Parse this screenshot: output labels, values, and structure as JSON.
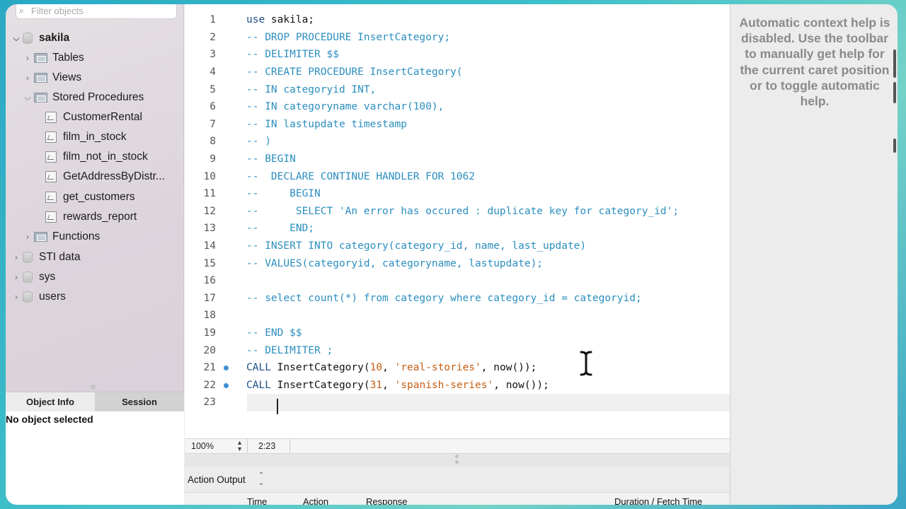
{
  "sidebar": {
    "filter_placeholder": "Filter objects",
    "tree": {
      "schema": "sakila",
      "tables": "Tables",
      "views": "Views",
      "stored_procedures": "Stored Procedures",
      "procedures": [
        "CustomerRental",
        "film_in_stock",
        "film_not_in_stock",
        "GetAddressByDistr...",
        "get_customers",
        "rewards_report"
      ],
      "functions": "Functions",
      "other_schemas": [
        "STI data",
        "sys",
        "users"
      ]
    },
    "info_tabs": {
      "object_info": "Object Info",
      "session": "Session"
    },
    "info_text": "No object selected"
  },
  "editor": {
    "line_numbers": [
      "1",
      "2",
      "3",
      "4",
      "5",
      "6",
      "7",
      "8",
      "9",
      "10",
      "11",
      "12",
      "13",
      "14",
      "15",
      "16",
      "17",
      "18",
      "19",
      "20",
      "21",
      "22",
      "23"
    ],
    "l1": {
      "kw": "use",
      "id": " sakila;"
    },
    "comments": {
      "l2": "-- DROP PROCEDURE InsertCategory;",
      "l3": "-- DELIMITER $$",
      "l4": "-- CREATE PROCEDURE InsertCategory(",
      "l5": "-- IN categoryid INT,",
      "l6": "-- IN categoryname varchar(100),",
      "l7": "-- IN lastupdate timestamp",
      "l8": "-- )",
      "l9": "-- BEGIN",
      "l10": "--  DECLARE CONTINUE HANDLER FOR 1062",
      "l11": "--     BEGIN",
      "l12": "--      SELECT 'An error has occured : duplicate key for category_id';",
      "l13": "--     END;",
      "l14": "-- INSERT INTO category(category_id, name, last_update)",
      "l15": "-- VALUES(categoryid, categoryname, lastupdate);",
      "l17": "-- select count(*) from category where category_id = categoryid;",
      "l19": "-- END $$",
      "l20": "-- DELIMITER ;"
    },
    "l21": {
      "kw": "CALL",
      "fn": " InsertCategory(",
      "num": "10",
      "sep1": ", ",
      "str": "'real-stories'",
      "sep2": ", ",
      "now": "now",
      "end": "());"
    },
    "l22": {
      "kw": "CALL",
      "fn": " InsertCategory(",
      "num": "31",
      "sep1": ", ",
      "str": "'spanish-series'",
      "sep2": ", ",
      "now": "now",
      "end": "());"
    },
    "colors": {
      "keyword": "#1d4e86",
      "comment": "#2b8ebf",
      "literal": "#c45e13",
      "breakpoint": "#3d8fd4"
    }
  },
  "statusbar": {
    "zoom": "100%",
    "cursor_position": "2:23"
  },
  "output": {
    "title": "Action Output",
    "columns": [
      "Time",
      "Action",
      "Response",
      "Duration / Fetch Time"
    ]
  },
  "help": {
    "text": "Automatic context help is disabled. Use the toolbar to manually get help for the current caret position or to toggle automatic help."
  }
}
